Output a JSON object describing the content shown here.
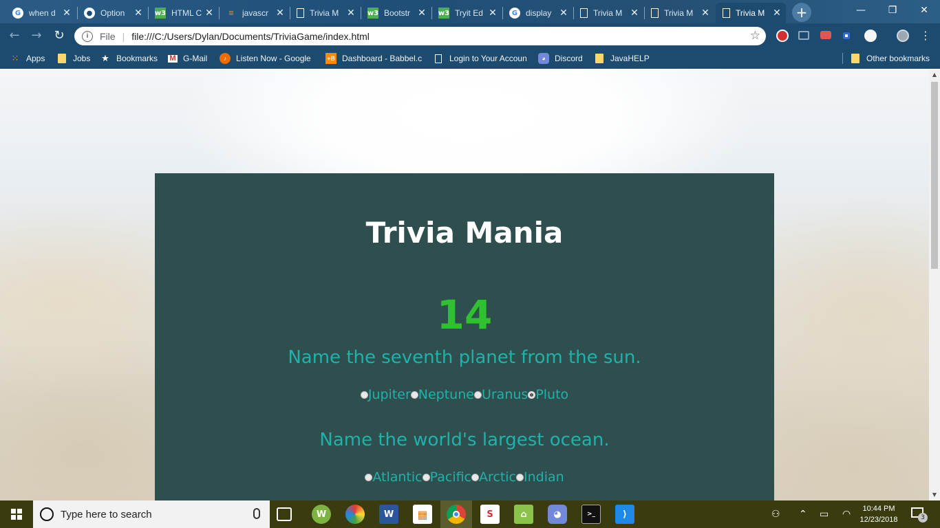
{
  "browser": {
    "tabs": [
      {
        "label": "when d",
        "icon": "google-icon",
        "color": "#ffffff"
      },
      {
        "label": "Option",
        "icon": "github-icon",
        "color": "#ffffff"
      },
      {
        "label": "HTML C",
        "icon": "w3schools-icon",
        "color": "#4caf50"
      },
      {
        "label": "javascr",
        "icon": "stackoverflow-icon",
        "color": "#b08a5a"
      },
      {
        "label": "Trivia M",
        "icon": "page-icon",
        "color": "#ffffff"
      },
      {
        "label": "Bootstr",
        "icon": "w3schools-icon",
        "color": "#4caf50"
      },
      {
        "label": "Tryit Ed",
        "icon": "w3schools-icon",
        "color": "#4caf50"
      },
      {
        "label": "display",
        "icon": "google-icon",
        "color": "#ffffff"
      },
      {
        "label": "Trivia M",
        "icon": "page-icon",
        "color": "#ffffff"
      },
      {
        "label": "Trivia M",
        "icon": "page-icon",
        "color": "#ffffff"
      },
      {
        "label": "Trivia M",
        "icon": "page-icon",
        "color": "#ffffff",
        "active": true
      }
    ],
    "address": {
      "scheme": "File",
      "url": "file:///C:/Users/Dylan/Documents/TriviaGame/index.html"
    },
    "bookmarks": [
      {
        "label": "Apps",
        "icon": "apps-grid-icon"
      },
      {
        "label": "Jobs",
        "icon": "folder-icon"
      },
      {
        "label": "Bookmarks",
        "icon": "star-icon"
      },
      {
        "label": "G-Mail",
        "icon": "gmail-icon"
      },
      {
        "label": "Listen Now - Google",
        "icon": "play-music-icon"
      },
      {
        "label": "Dashboard - Babbel.c",
        "icon": "babbel-icon"
      },
      {
        "label": "Login to Your Accoun",
        "icon": "page-icon"
      },
      {
        "label": "Discord",
        "icon": "discord-icon"
      },
      {
        "label": "JavaHELP",
        "icon": "folder-icon"
      }
    ],
    "other_bookmarks": "Other bookmarks"
  },
  "page": {
    "title": "Trivia Mania",
    "timer": "14",
    "questions": [
      {
        "text": "Name the seventh planet from the sun.",
        "answers": [
          "Jupiter",
          "Neptune",
          "Uranus",
          "Pluto"
        ],
        "selected": 3
      },
      {
        "text": "Name the world's largest ocean.",
        "answers": [
          "Atlantic",
          "Pacific",
          "Arctic",
          "Indian"
        ],
        "selected": null
      }
    ],
    "colors": {
      "panel": "#2f4f4f",
      "title": "#ffffff",
      "timer": "#2fc12f",
      "question": "#20b2aa"
    }
  },
  "taskbar": {
    "search_placeholder": "Type here to search",
    "time": "10:44 PM",
    "date": "12/23/2018",
    "notifications": "3"
  }
}
